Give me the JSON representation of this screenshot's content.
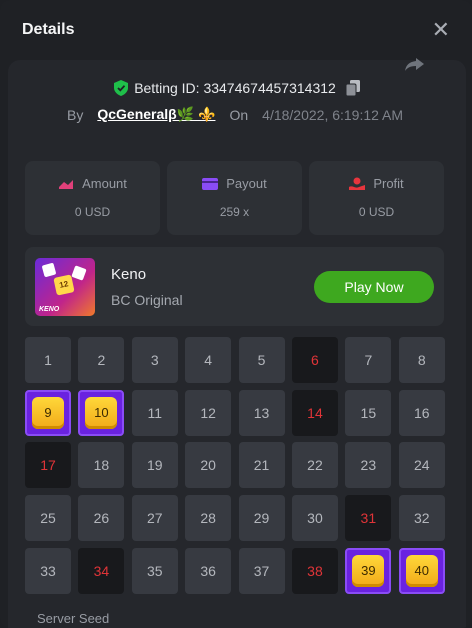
{
  "modal": {
    "title": "Details"
  },
  "bet": {
    "id_text": "Betting ID: 334746744573143​12",
    "by_label": "By",
    "user": "QcGeneralβ🌿 ⚜️",
    "on_label": "On",
    "date": "4/18/2022, 6:19:12 AM"
  },
  "stats": [
    {
      "label": "Amount",
      "value": "0 USD",
      "icon": "amount-icon"
    },
    {
      "label": "Payout",
      "value": "259 x",
      "icon": "payout-icon"
    },
    {
      "label": "Profit",
      "value": "0 USD",
      "icon": "profit-icon"
    }
  ],
  "game": {
    "name": "Keno",
    "subtitle": "BC Original",
    "play_label": "Play Now",
    "thumb_text": "KENO",
    "thumb_ball": "12"
  },
  "grid": {
    "cells": [
      {
        "n": "1",
        "state": "normal"
      },
      {
        "n": "2",
        "state": "normal"
      },
      {
        "n": "3",
        "state": "normal"
      },
      {
        "n": "4",
        "state": "normal"
      },
      {
        "n": "5",
        "state": "normal"
      },
      {
        "n": "6",
        "state": "miss"
      },
      {
        "n": "7",
        "state": "normal"
      },
      {
        "n": "8",
        "state": "normal"
      },
      {
        "n": "9",
        "state": "hit"
      },
      {
        "n": "10",
        "state": "hit"
      },
      {
        "n": "11",
        "state": "normal"
      },
      {
        "n": "12",
        "state": "normal"
      },
      {
        "n": "13",
        "state": "normal"
      },
      {
        "n": "14",
        "state": "miss"
      },
      {
        "n": "15",
        "state": "normal"
      },
      {
        "n": "16",
        "state": "normal"
      },
      {
        "n": "17",
        "state": "miss"
      },
      {
        "n": "18",
        "state": "normal"
      },
      {
        "n": "19",
        "state": "normal"
      },
      {
        "n": "20",
        "state": "normal"
      },
      {
        "n": "21",
        "state": "normal"
      },
      {
        "n": "22",
        "state": "normal"
      },
      {
        "n": "23",
        "state": "normal"
      },
      {
        "n": "24",
        "state": "normal"
      },
      {
        "n": "25",
        "state": "normal"
      },
      {
        "n": "26",
        "state": "normal"
      },
      {
        "n": "27",
        "state": "normal"
      },
      {
        "n": "28",
        "state": "normal"
      },
      {
        "n": "29",
        "state": "normal"
      },
      {
        "n": "30",
        "state": "normal"
      },
      {
        "n": "31",
        "state": "miss"
      },
      {
        "n": "32",
        "state": "normal"
      },
      {
        "n": "33",
        "state": "normal"
      },
      {
        "n": "34",
        "state": "miss"
      },
      {
        "n": "35",
        "state": "normal"
      },
      {
        "n": "36",
        "state": "normal"
      },
      {
        "n": "37",
        "state": "normal"
      },
      {
        "n": "38",
        "state": "miss"
      },
      {
        "n": "39",
        "state": "hit"
      },
      {
        "n": "40",
        "state": "hit"
      }
    ]
  },
  "footer": {
    "server_seed_label": "Server Seed"
  },
  "colors": {
    "accent_green": "#3ea81f",
    "hit_purple": "#6a22e0",
    "miss_red": "#e03438",
    "verified_green": "#1fbf4a"
  }
}
